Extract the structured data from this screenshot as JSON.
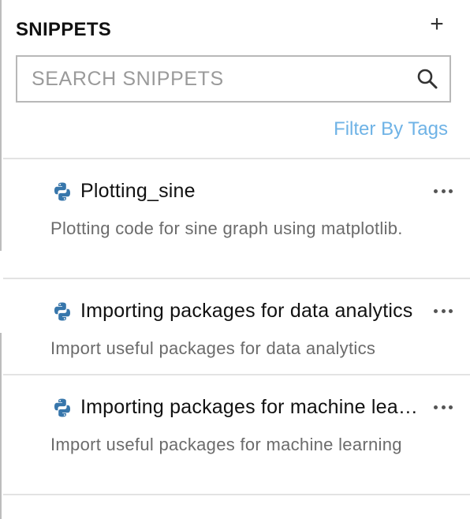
{
  "panel": {
    "title": "SNIPPETS",
    "add_label": "+"
  },
  "search": {
    "placeholder": "SEARCH SNIPPETS",
    "value": ""
  },
  "filter": {
    "label": "Filter By Tags"
  },
  "snippets": [
    {
      "name": "Plotting_sine",
      "description": "Plotting code for sine graph using matplotlib.",
      "language_icon": "python-icon"
    },
    {
      "name": "Importing packages for data analytics",
      "description": "Import useful packages for data analytics",
      "language_icon": "python-icon"
    },
    {
      "name": "Importing packages for machine learning",
      "description": "Import useful packages for machine learning",
      "language_icon": "python-icon"
    }
  ],
  "colors": {
    "accent": "#6fb3e6",
    "python_blue": "#3776ab",
    "python_yellow": "#ffd43b",
    "muted_text": "#6b6b6b"
  }
}
